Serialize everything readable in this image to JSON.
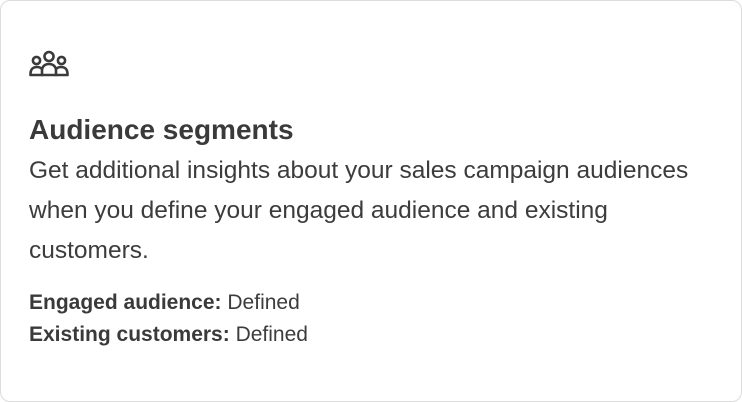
{
  "card": {
    "icon": "group-people-icon",
    "title": "Audience segments",
    "description": "Get additional insights about your sales campaign audiences when you define your engaged audience and existing customers.",
    "details": [
      {
        "label": "Engaged audience:",
        "value": "Defined"
      },
      {
        "label": "Existing customers:",
        "value": "Defined"
      }
    ]
  }
}
